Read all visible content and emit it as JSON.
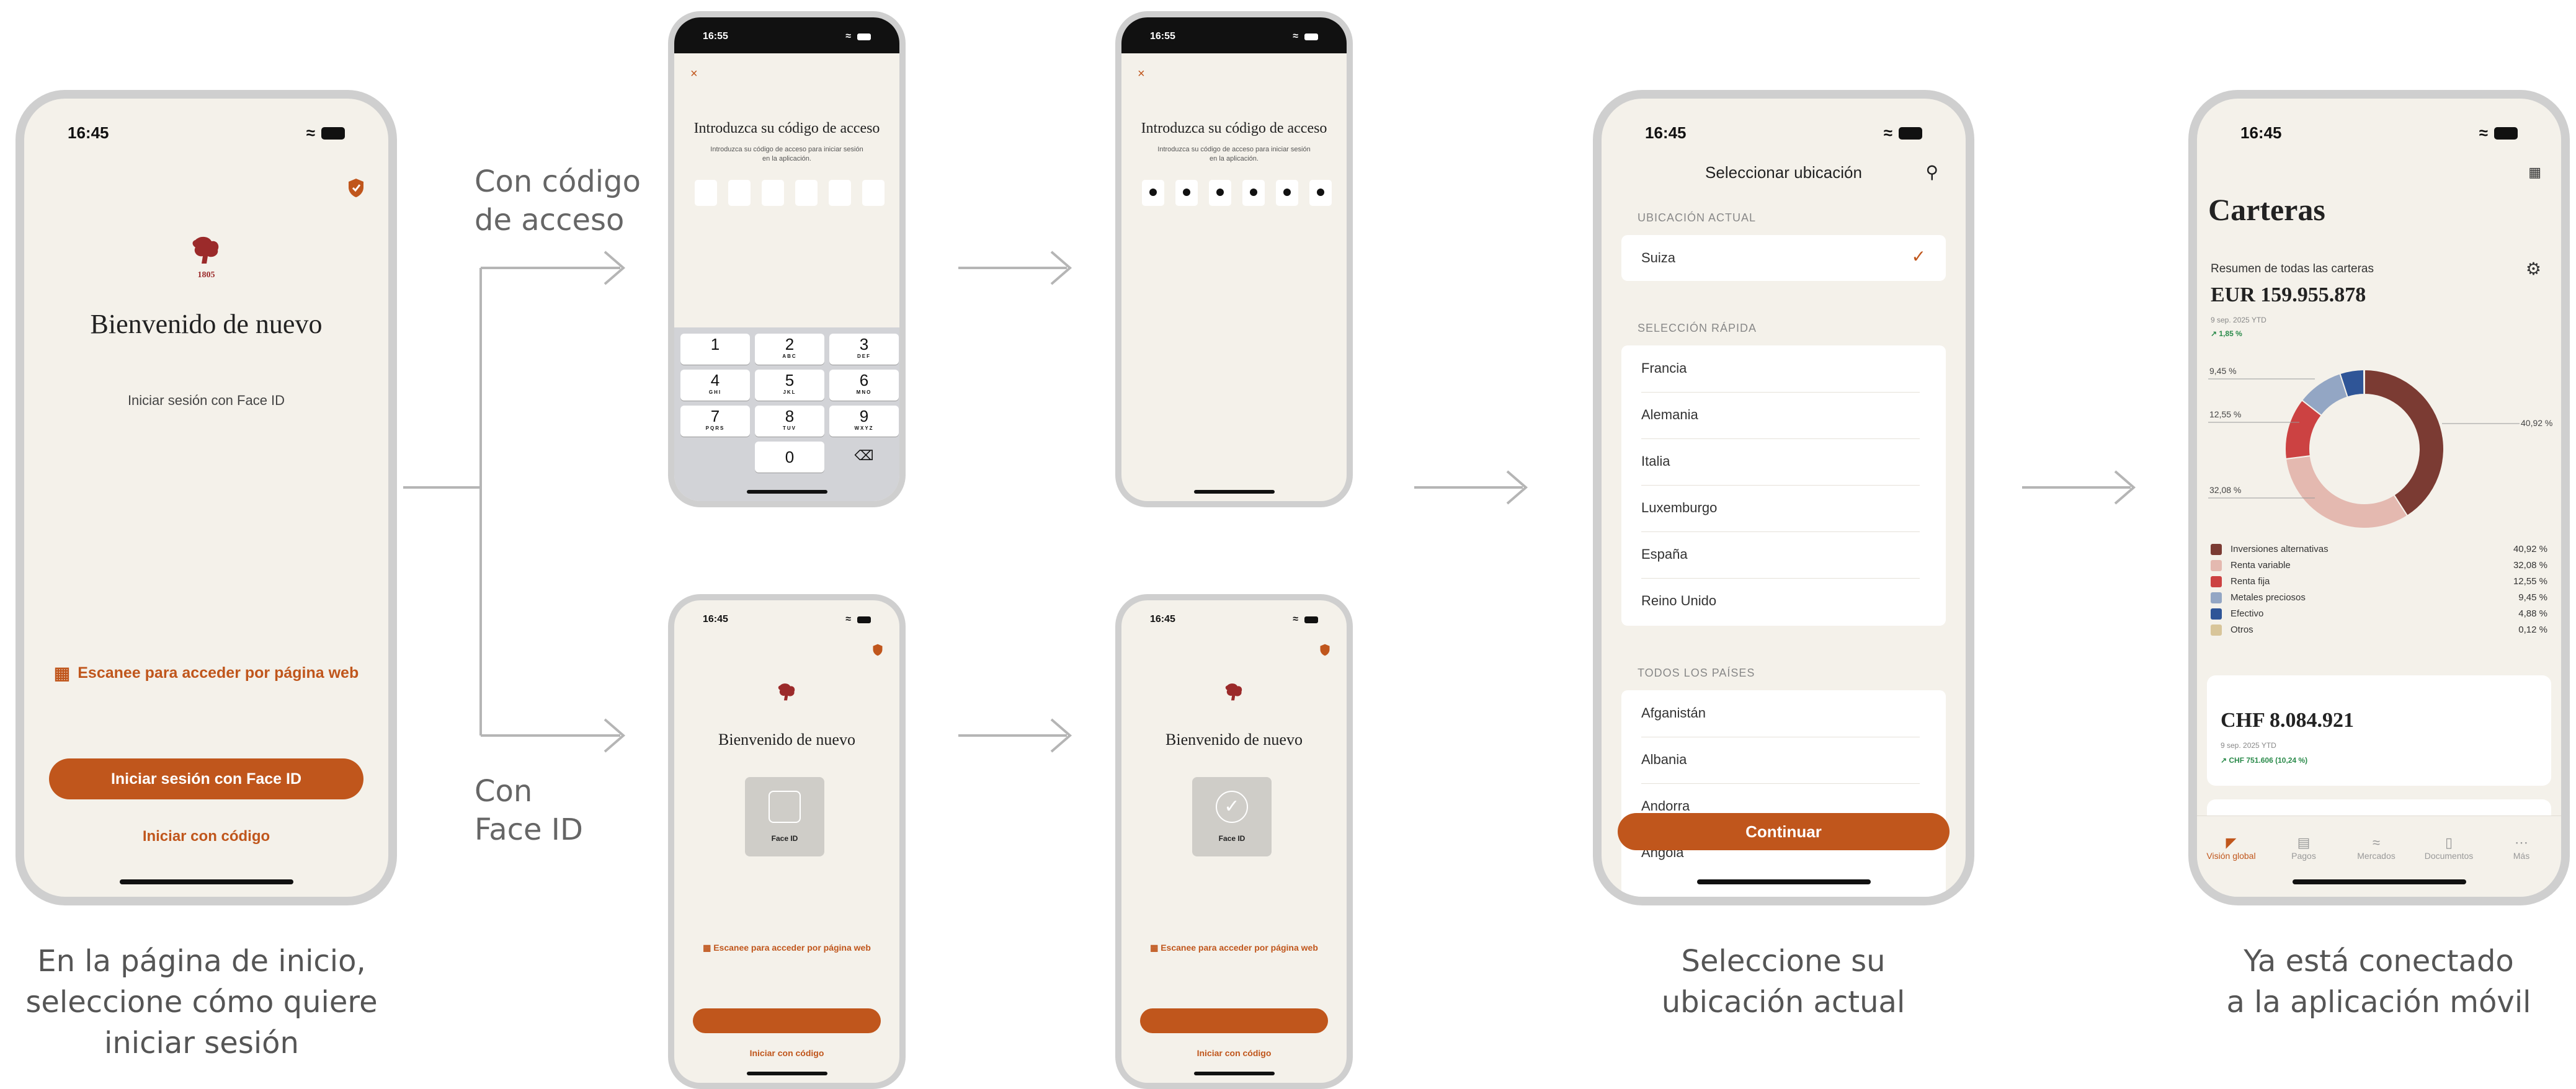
{
  "captions": {
    "start": [
      "En la página de inicio,",
      "seleccione cómo quiere",
      "iniciar sesión"
    ],
    "location": [
      "Seleccione su",
      "ubicación actual"
    ],
    "done": [
      "Ya está conectado",
      "a la aplicación móvil"
    ]
  },
  "branch_labels": {
    "code": [
      "Con código",
      "de acceso"
    ],
    "faceid": [
      "Con",
      "Face ID"
    ]
  },
  "colors": {
    "accent": "#c0561c",
    "crest": "#9b2a2a",
    "background": "#f4f1ea"
  },
  "welcome_screen": {
    "time": "16:45",
    "crest_year": "1805",
    "title": "Bienvenido de nuevo",
    "subtitle": "Iniciar sesión con Face ID",
    "scan_link": "Escanee para acceder por página web",
    "primary_button": "Iniciar sesión con Face ID",
    "secondary_link": "Iniciar con código"
  },
  "passcode_screen": {
    "time": "16:55",
    "close": "×",
    "title": "Introduzca su código de acceso",
    "hint": [
      "Introduzca su código de acceso para iniciar sesión",
      "en la aplicación."
    ],
    "keys": [
      {
        "n": "1",
        "l": ""
      },
      {
        "n": "2",
        "l": "ABC"
      },
      {
        "n": "3",
        "l": "DEF"
      },
      {
        "n": "4",
        "l": "GHI"
      },
      {
        "n": "5",
        "l": "JKL"
      },
      {
        "n": "6",
        "l": "MNO"
      },
      {
        "n": "7",
        "l": "PQRS"
      },
      {
        "n": "8",
        "l": "TUV"
      },
      {
        "n": "9",
        "l": "WXYZ"
      },
      {
        "n": "0",
        "l": ""
      }
    ],
    "delete_key": "⌫"
  },
  "faceid_screen": {
    "time": "16:45",
    "title": "Bienvenido de nuevo",
    "face_id_label": "Face ID",
    "scan_link": "Escanee para acceder por página web",
    "secondary_link": "Iniciar con código"
  },
  "location_screen": {
    "time": "16:45",
    "title": "Seleccionar ubicación",
    "current_header": "UBICACIÓN ACTUAL",
    "current": "Suiza",
    "quick_header": "SELECCIÓN RÁPIDA",
    "quick": [
      "Francia",
      "Alemania",
      "Italia",
      "Luxemburgo",
      "España",
      "Reino Unido"
    ],
    "all_header": "TODOS LOS PAÍSES",
    "all": [
      "Afganistán",
      "Albania",
      "Andorra",
      "Angola"
    ],
    "continue_button": "Continuar"
  },
  "portfolio_screen": {
    "time": "16:45",
    "title": "Carteras",
    "summary_label": "Resumen de todas las carteras",
    "total": "EUR 159.955.878",
    "date": "9 sep. 2025 YTD",
    "change": "1,85 %",
    "donut_labels": {
      "a": "9,45 %",
      "b": "12,55 %",
      "c": "32,08 %",
      "d": "40,92 %"
    },
    "legend": [
      {
        "label": "Inversiones alternativas",
        "value": "40,92 %",
        "share": 40.92,
        "color": "#7b3b33"
      },
      {
        "label": "Renta variable",
        "value": "32,08 %",
        "share": 32.08,
        "color": "#e4b9b0"
      },
      {
        "label": "Renta fija",
        "value": "12,55 %",
        "share": 12.55,
        "color": "#cc4242"
      },
      {
        "label": "Metales preciosos",
        "value": "9,45 %",
        "share": 9.45,
        "color": "#93a6c4"
      },
      {
        "label": "Efectivo",
        "value": "4,88 %",
        "share": 4.88,
        "color": "#2f5597"
      },
      {
        "label": "Otros",
        "value": "0,12 %",
        "share": 0.12,
        "color": "#d8c59a"
      }
    ],
    "card2_total": "CHF 8.084.921",
    "card2_date": "9 sep. 2025 YTD",
    "card2_change": "CHF 751.606 (10,24 %)",
    "tabs": [
      "Visión global",
      "Pagos",
      "Mercados",
      "Documentos",
      "Más"
    ]
  }
}
